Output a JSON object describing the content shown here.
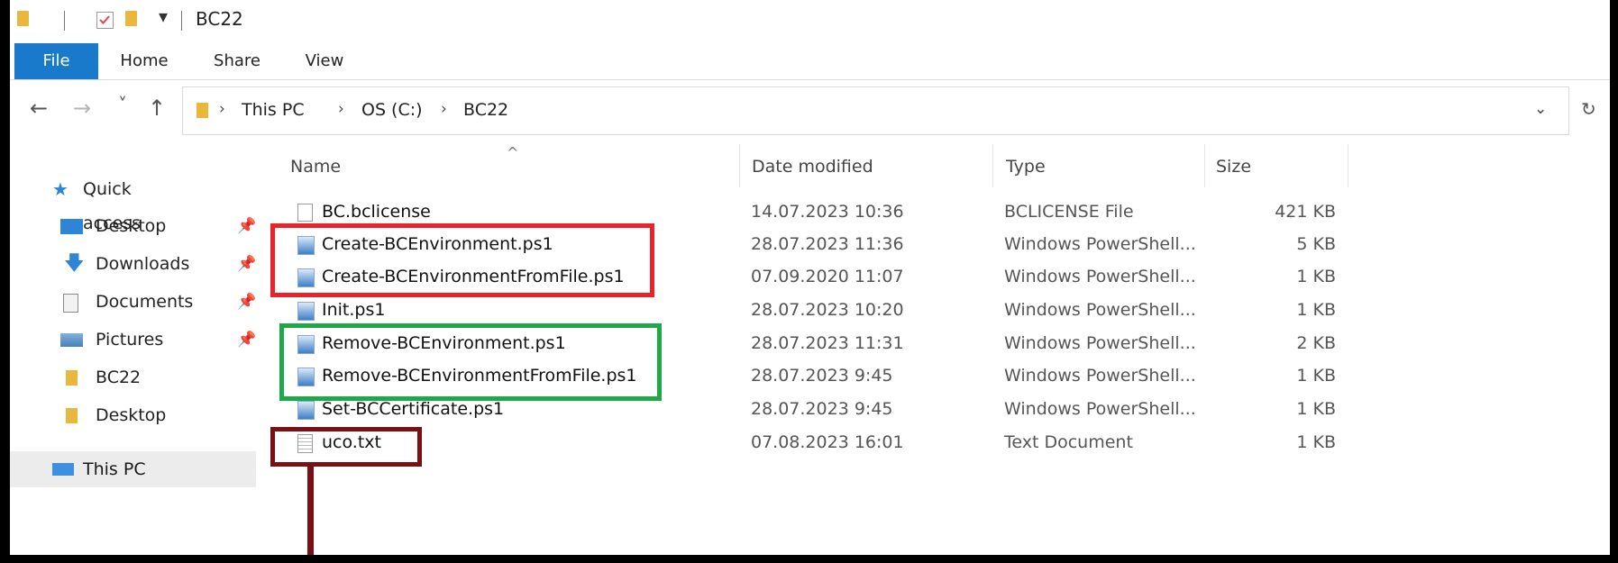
{
  "window": {
    "title": "BC22",
    "qa_dropdown_glyph": "▾"
  },
  "ribbon": {
    "tabs": [
      {
        "label": "File",
        "active": true
      },
      {
        "label": "Home"
      },
      {
        "label": "Share"
      },
      {
        "label": "View"
      }
    ]
  },
  "navigation": {
    "back_icon": "←",
    "forward_icon": "→",
    "recent_icon": "˅",
    "up_icon": "↑",
    "breadcrumb": [
      "This PC",
      "OS (C:)",
      "BC22"
    ],
    "separator": "›",
    "dropdown_icon": "⌄",
    "refresh_icon": "↻"
  },
  "nav_pane": {
    "quick_access_label": "Quick access",
    "items": [
      {
        "label": "Desktop",
        "icon": "desktop-icon",
        "pinned": true
      },
      {
        "label": "Downloads",
        "icon": "downloads-icon",
        "pinned": true
      },
      {
        "label": "Documents",
        "icon": "documents-icon",
        "pinned": true
      },
      {
        "label": "Pictures",
        "icon": "pictures-icon",
        "pinned": true
      },
      {
        "label": "BC22",
        "icon": "folder-icon",
        "pinned": false
      },
      {
        "label": "Desktop",
        "icon": "desktop-shortcut-icon",
        "pinned": false
      }
    ],
    "this_pc_label": "This PC",
    "pin_glyph": "📌"
  },
  "file_list": {
    "columns": {
      "name": "Name",
      "date": "Date modified",
      "type": "Type",
      "size": "Size"
    },
    "sort_indicator": "^",
    "files": [
      {
        "name": "BC.bclicense",
        "date": "14.07.2023 10:36",
        "type": "BCLICENSE File",
        "size": "421 KB",
        "icon": "generic-file-icon"
      },
      {
        "name": "Create-BCEnvironment.ps1",
        "date": "28.07.2023 11:36",
        "type": "Windows PowerShell...",
        "size": "5 KB",
        "icon": "powershell-script-icon"
      },
      {
        "name": "Create-BCEnvironmentFromFile.ps1",
        "date": "07.09.2020 11:07",
        "type": "Windows PowerShell...",
        "size": "1 KB",
        "icon": "powershell-script-icon"
      },
      {
        "name": "Init.ps1",
        "date": "28.07.2023 10:20",
        "type": "Windows PowerShell...",
        "size": "1 KB",
        "icon": "powershell-script-icon"
      },
      {
        "name": "Remove-BCEnvironment.ps1",
        "date": "28.07.2023 11:31",
        "type": "Windows PowerShell...",
        "size": "2 KB",
        "icon": "powershell-script-icon"
      },
      {
        "name": "Remove-BCEnvironmentFromFile.ps1",
        "date": "28.07.2023 9:45",
        "type": "Windows PowerShell...",
        "size": "1 KB",
        "icon": "powershell-script-icon"
      },
      {
        "name": "Set-BCCertificate.ps1",
        "date": "28.07.2023 9:45",
        "type": "Windows PowerShell...",
        "size": "1 KB",
        "icon": "powershell-script-icon"
      },
      {
        "name": "uco.txt",
        "date": "07.08.2023 16:01",
        "type": "Text Document",
        "size": "1 KB",
        "icon": "text-file-icon"
      }
    ]
  },
  "annotations": {
    "red": "#e8232a",
    "green": "#1fa84a",
    "maroon": "#7b0f16"
  },
  "colors": {
    "accent": "#1979ca",
    "folder": "#e8b73c"
  }
}
